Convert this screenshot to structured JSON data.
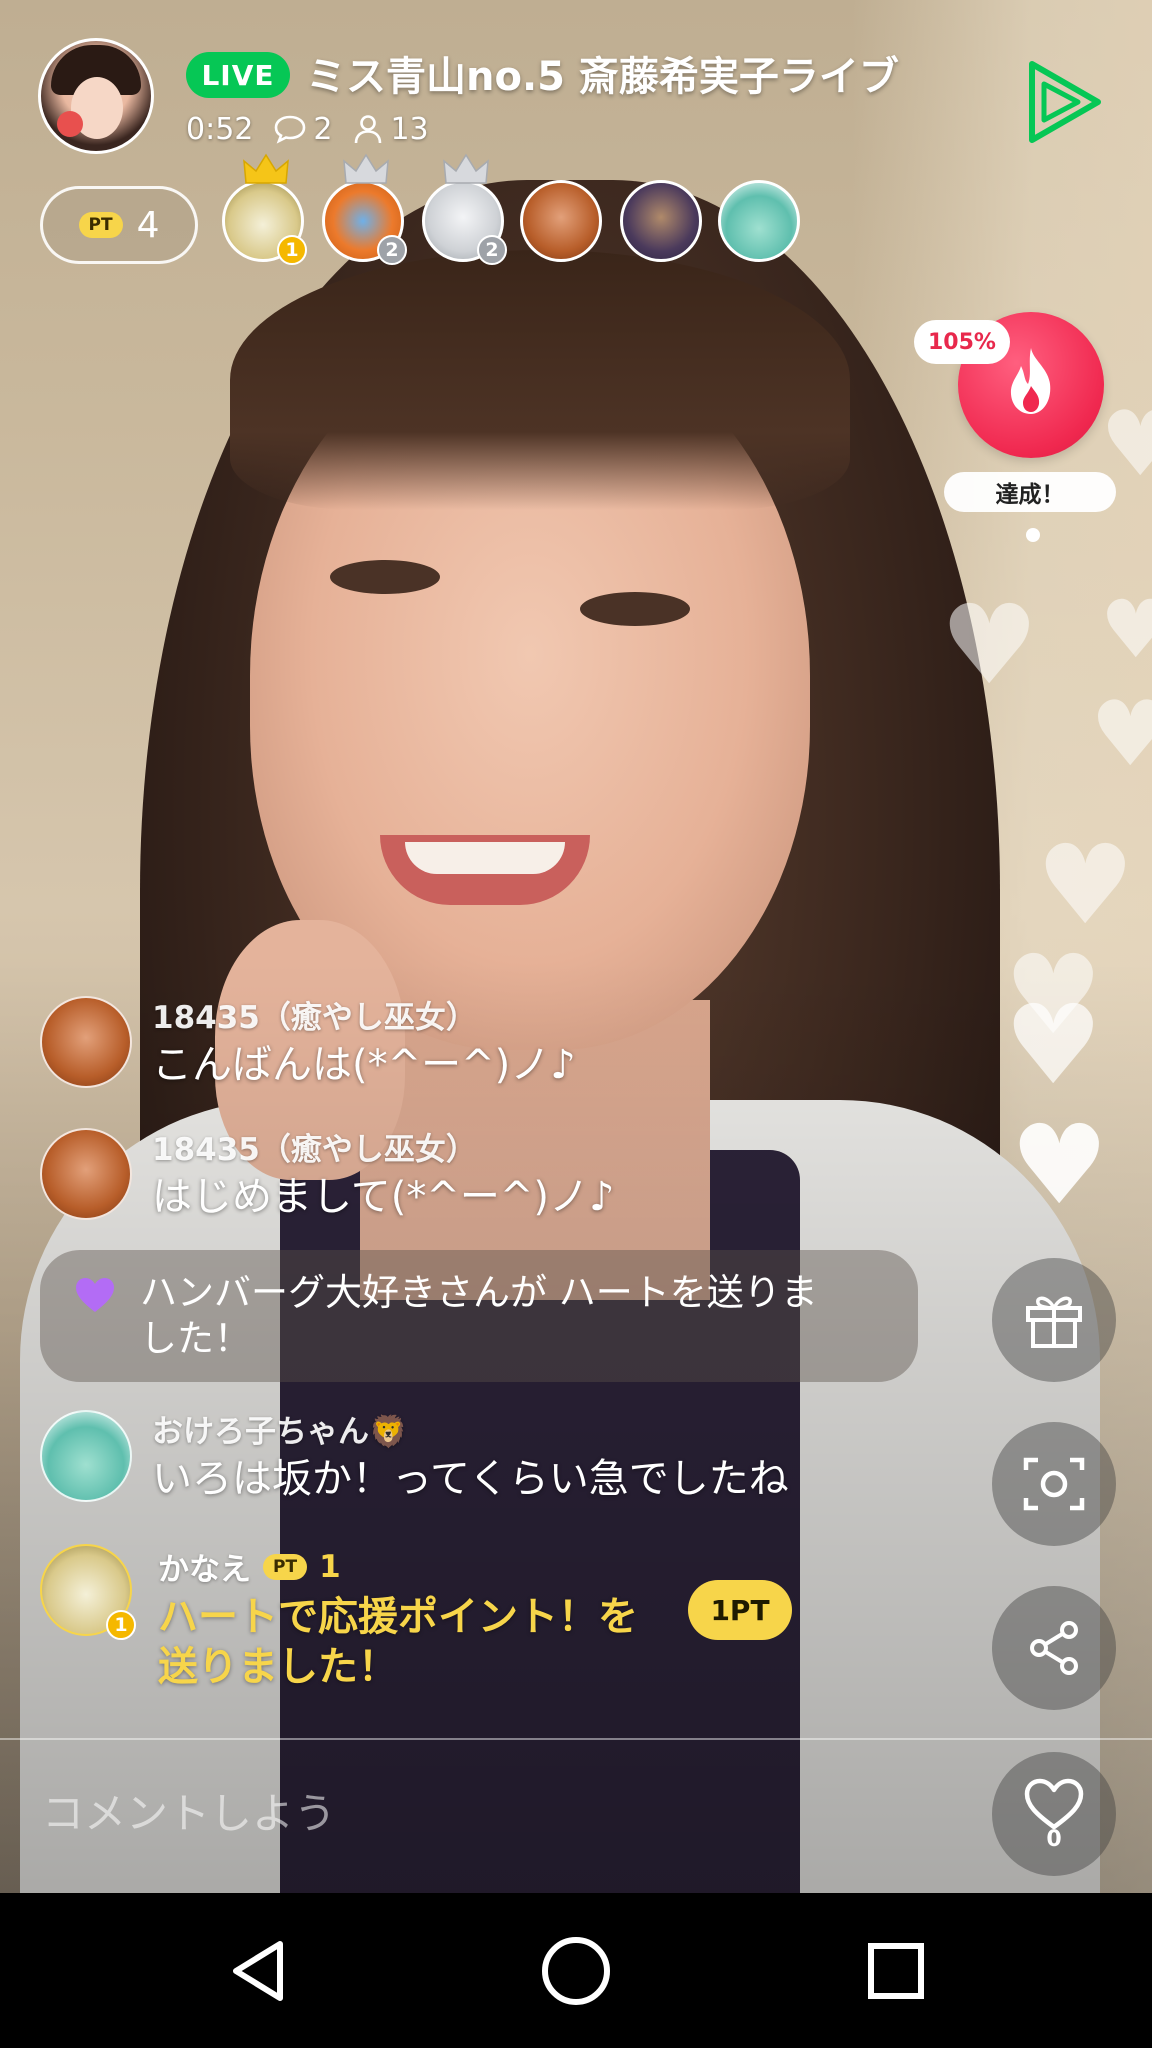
{
  "header": {
    "live_label": "LIVE",
    "title": "ミス青山no.5 斎藤希実子ライブ",
    "elapsed": "0:52",
    "comment_count": "2",
    "viewer_count": "13"
  },
  "points": {
    "badge": "PT",
    "value": "4"
  },
  "rankers": [
    {
      "rank": "1",
      "crown": "gold"
    },
    {
      "rank": "2",
      "crown": "silver"
    },
    {
      "rank": "2",
      "crown": "silver"
    }
  ],
  "gauge": {
    "percent": "105%",
    "label": "達成！"
  },
  "chat": [
    {
      "name": "18435（癒やし巫女）",
      "text": "こんばんは(*^ー^)ノ♪"
    },
    {
      "name": "18435（癒やし巫女）",
      "text": "はじめまして(*^ー^)ノ♪"
    },
    {
      "line1": "ハンバーグ大好きさんが ハートを送りま",
      "line2": "した！"
    },
    {
      "name": "おけろ子ちゃん🦁",
      "text": "いろは坂か！ってくらい急でしたね"
    },
    {
      "name": "かなえ",
      "pt_badge": "PT",
      "pt_value": "1",
      "line1": "ハートで応援ポイント！を",
      "line2": "送りました！",
      "chip": "1PT",
      "rank": "1"
    }
  ],
  "comment": {
    "placeholder": "コメントしよう"
  },
  "like": {
    "count": "0"
  },
  "colors": {
    "live_green": "#06c755",
    "accent_yellow": "#f7d54a",
    "gauge_red": "#f0284f",
    "heart_purple": "#b36cf5"
  },
  "icons": [
    "comment-icon",
    "viewer-icon",
    "play-triangle-icon",
    "crown-icon",
    "flame-icon",
    "heart-icon",
    "gift-icon",
    "screenshot-icon",
    "share-icon",
    "back-icon",
    "home-icon",
    "recents-icon"
  ]
}
